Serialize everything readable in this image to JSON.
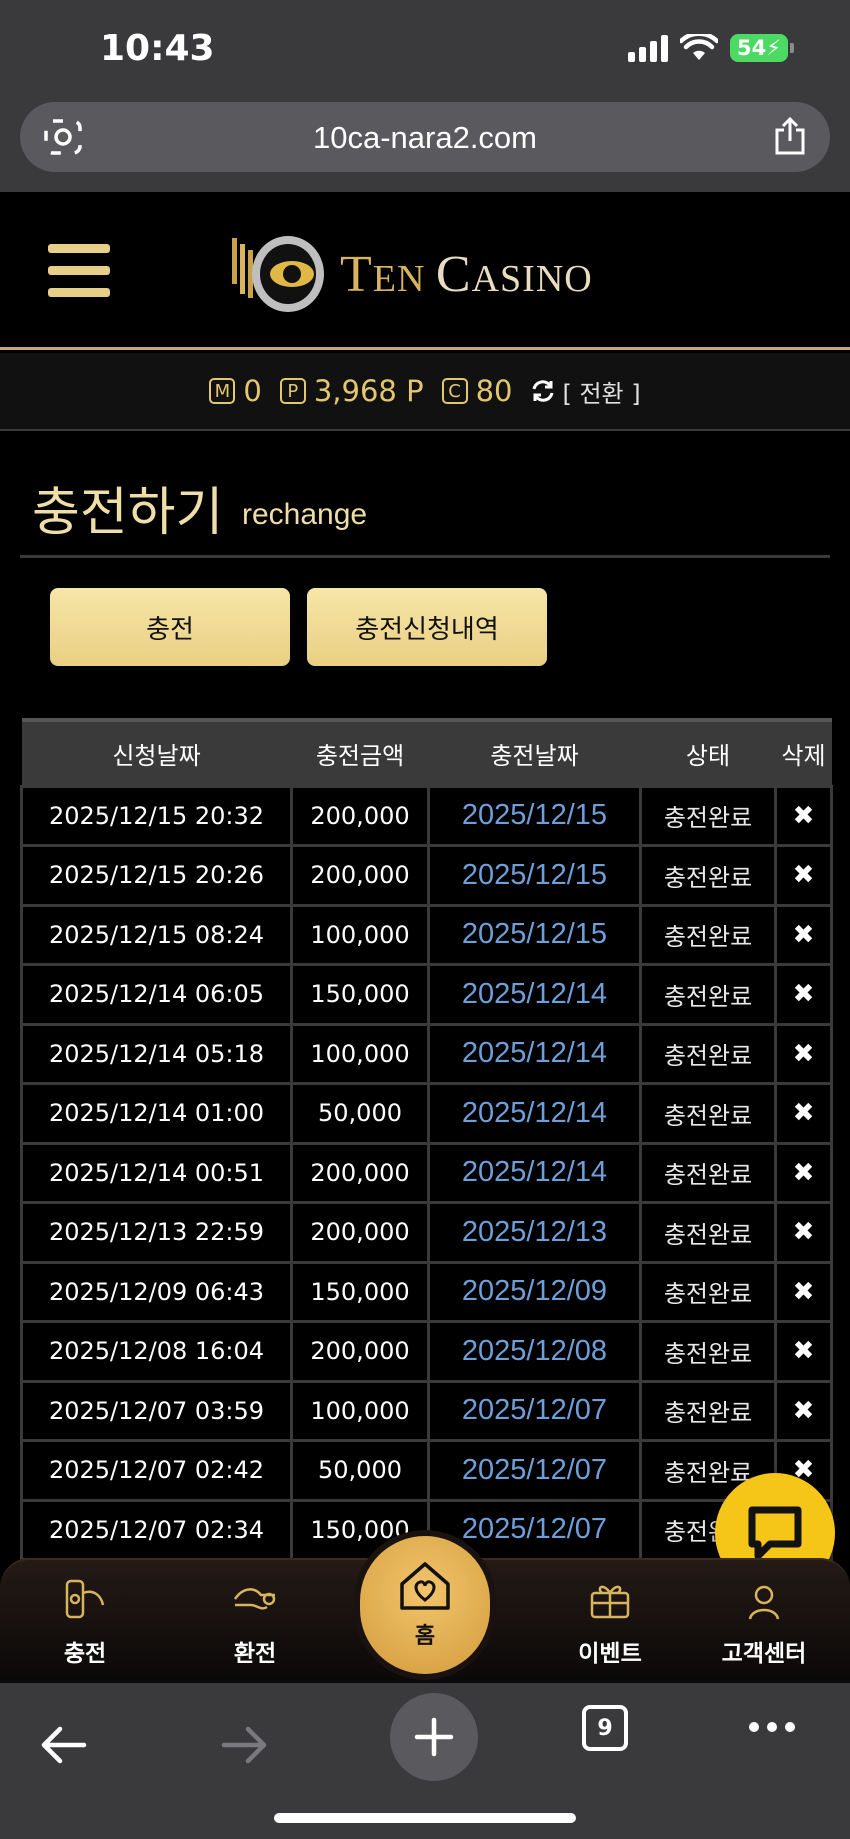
{
  "status_bar": {
    "time": "10:43",
    "battery": "54"
  },
  "browser": {
    "url": "10ca-nara2.com",
    "tab_count": "9"
  },
  "logo": {
    "text_first": "T",
    "text_en": "EN ",
    "text_c": "C",
    "text_asino": "ASINO"
  },
  "points": {
    "m_label": "M",
    "m_value": "0",
    "p_label": "P",
    "p_value": "3,968 P",
    "c_label": "C",
    "c_value": "80",
    "convert_label": "[ 전환 ]"
  },
  "page": {
    "title": "충전하기",
    "subtitle": "rechange"
  },
  "buttons": {
    "charge": "충전",
    "history": "충전신청내역"
  },
  "table": {
    "headers": [
      "신청날짜",
      "충전금액",
      "충전날짜",
      "상태",
      "삭제"
    ],
    "rows": [
      [
        "2025/12/15 20:32",
        "200,000",
        "2025/12/15",
        "충전완료",
        "✖"
      ],
      [
        "2025/12/15 20:26",
        "200,000",
        "2025/12/15",
        "충전완료",
        "✖"
      ],
      [
        "2025/12/15 08:24",
        "100,000",
        "2025/12/15",
        "충전완료",
        "✖"
      ],
      [
        "2025/12/14 06:05",
        "150,000",
        "2025/12/14",
        "충전완료",
        "✖"
      ],
      [
        "2025/12/14 05:18",
        "100,000",
        "2025/12/14",
        "충전완료",
        "✖"
      ],
      [
        "2025/12/14 01:00",
        "50,000",
        "2025/12/14",
        "충전완료",
        "✖"
      ],
      [
        "2025/12/14 00:51",
        "200,000",
        "2025/12/14",
        "충전완료",
        "✖"
      ],
      [
        "2025/12/13 22:59",
        "200,000",
        "2025/12/13",
        "충전완료",
        "✖"
      ],
      [
        "2025/12/09 06:43",
        "150,000",
        "2025/12/09",
        "충전완료",
        "✖"
      ],
      [
        "2025/12/08 16:04",
        "200,000",
        "2025/12/08",
        "충전완료",
        "✖"
      ],
      [
        "2025/12/07 03:59",
        "100,000",
        "2025/12/07",
        "충전완료",
        "✖"
      ],
      [
        "2025/12/07 02:42",
        "50,000",
        "2025/12/07",
        "충전완료",
        "✖"
      ],
      [
        "2025/12/07 02:34",
        "150,000",
        "2025/12/07",
        "충전완료",
        "✖"
      ]
    ]
  },
  "bottom_nav": {
    "charge": "충전",
    "exchange": "환전",
    "home": "홈",
    "event": "이벤트",
    "support": "고객센터"
  },
  "colors": {
    "gold": "#e3c76f",
    "link_blue": "#6e9fd9",
    "button_gold": "#f6e6a8",
    "chat_yellow": "#f5c518"
  }
}
